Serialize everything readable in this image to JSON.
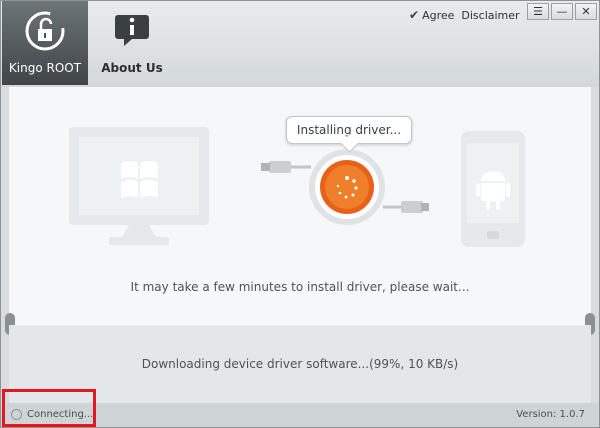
{
  "nav": {
    "items": [
      {
        "label": "Kingo ROOT",
        "icon": "unlock-icon",
        "active": true
      },
      {
        "label": "About Us",
        "icon": "info-bubble-icon",
        "active": false
      }
    ]
  },
  "header": {
    "agree_label": "Agree",
    "disclaimer_label": "Disclaimer"
  },
  "status_bubble": "Installing driver...",
  "messages": {
    "wait": "It may take a few minutes to install driver, please wait...",
    "download": "Downloading device driver software...(99%, 10 KB/s)"
  },
  "statusbar": {
    "connection": "Connecting...",
    "version": "Version: 1.0.7"
  },
  "colors": {
    "accent": "#e8611a",
    "highlight": "#e2191f",
    "active_nav": "#4b5154"
  }
}
